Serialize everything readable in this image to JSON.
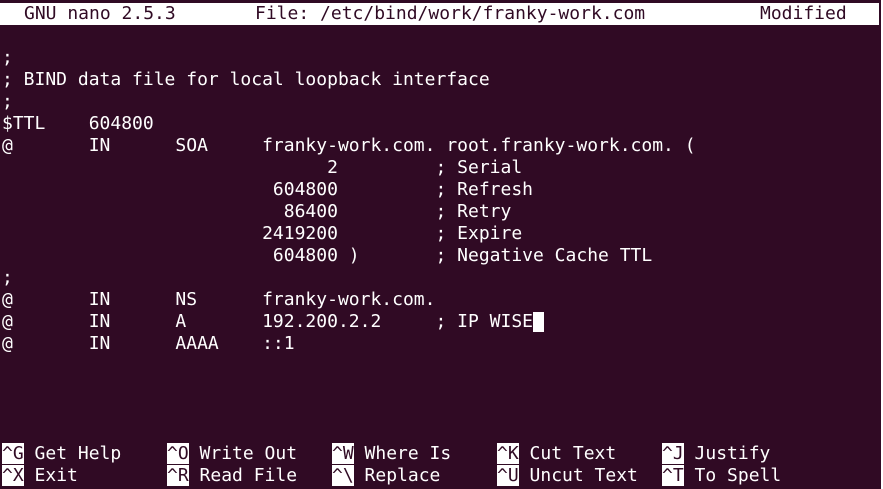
{
  "titlebar": {
    "version": "GNU nano 2.5.3",
    "file_label": "File: /etc/bind/work/franky-work.com",
    "status": "Modified"
  },
  "editor": {
    "lines": [
      ";",
      "; BIND data file for local loopback interface",
      ";",
      "$TTL    604800",
      "@       IN      SOA     franky-work.com. root.franky-work.com. (",
      "                              2         ; Serial",
      "                         604800         ; Refresh",
      "                          86400         ; Retry",
      "                        2419200         ; Expire",
      "                         604800 )       ; Negative Cache TTL",
      ";",
      "@       IN      NS      franky-work.com.",
      "@       IN      A       192.200.2.2     ; IP WISE",
      "@       IN      AAAA    ::1"
    ]
  },
  "shortcuts": [
    {
      "key": "^G",
      "label": " Get Help"
    },
    {
      "key": "^O",
      "label": " Write Out"
    },
    {
      "key": "^W",
      "label": " Where Is"
    },
    {
      "key": "^K",
      "label": " Cut Text"
    },
    {
      "key": "^J",
      "label": " Justify"
    },
    {
      "key": "^X",
      "label": " Exit"
    },
    {
      "key": "^R",
      "label": " Read File"
    },
    {
      "key": "^\\",
      "label": " Replace"
    },
    {
      "key": "^U",
      "label": " Uncut Text"
    },
    {
      "key": "^T",
      "label": " To Spell"
    }
  ],
  "colors": {
    "background": "#300a24",
    "foreground": "#ffffff"
  }
}
